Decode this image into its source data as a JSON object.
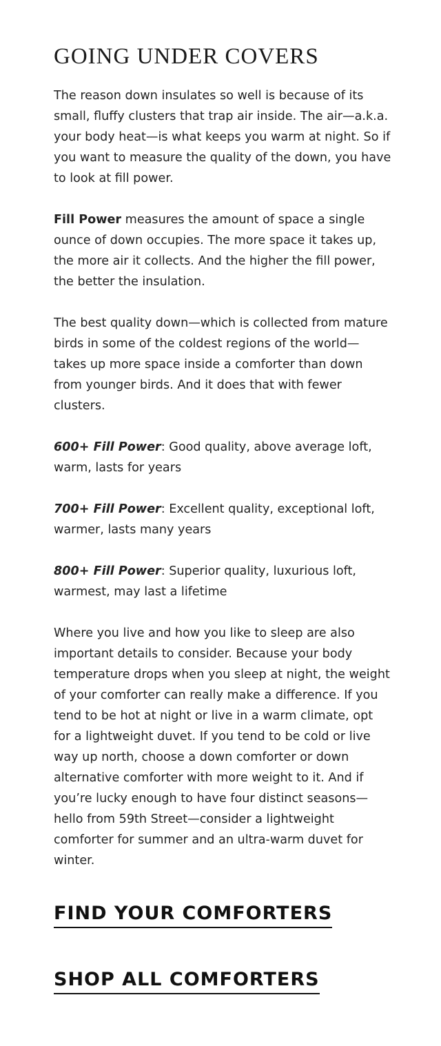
{
  "title": "GOING UNDER COVERS",
  "intro": "The reason down insulates so well is because of its small, fluffy clusters that trap air inside. The air—a.k.a. your body heat—is what keeps you warm at night. So if you want to measure the quality of the down, you have to look at fill power.",
  "fill_power": {
    "term": "Fill Power",
    "definition": " measures the amount of space a single ounce of down occupies. The more space it takes up, the more air it collects. And the higher the fill power, the better the insulation."
  },
  "best_quality": "The best quality down—which is collected from mature birds in some of the coldest regions of the world—takes up more space inside a comforter than down from younger birds. And it does that with fewer clusters.",
  "ratings": [
    {
      "label": "600+ Fill Power",
      "description": ": Good quality, above average loft, warm, lasts for years"
    },
    {
      "label": "700+ Fill Power",
      "description": ": Excellent quality, exceptional loft, warmer, lasts many years"
    },
    {
      "label": "800+ Fill Power",
      "description": ": Superior quality, luxurious loft, warmest, may last a lifetime"
    }
  ],
  "closing": "Where you live and how you like to sleep are also important details to consider. Because your body temperature drops when you sleep at night, the weight of your comforter can really make a difference. If you tend to be hot at night or live in a warm climate, opt for a lightweight duvet. If you tend to be cold or live way up north, choose a down comforter or down alternative comforter with more weight to it. And if you’re lucky enough to have four distinct seasons—hello from 59th Street—consider a lightweight comforter for summer and an ultra-warm duvet for winter.",
  "links": {
    "find": "FIND YOUR COMFORTERS",
    "shop": "SHOP ALL COMFORTERS"
  }
}
